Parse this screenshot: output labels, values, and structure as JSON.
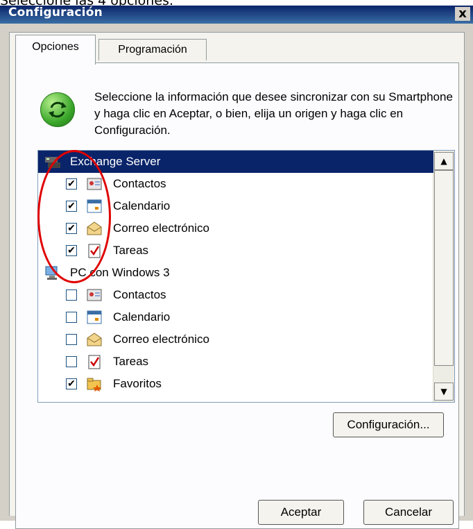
{
  "caption": "Seleccione las 4 opciones.",
  "window": {
    "title": "Configuración",
    "close_label": "x"
  },
  "tabs": [
    {
      "label": "Opciones"
    },
    {
      "label": "Programación"
    }
  ],
  "info_text": "Seleccione la información que desee sincronizar con su Smartphone y haga clic en Aceptar, o bien, elija un origen y haga clic en Configuración.",
  "tree": {
    "groups": [
      {
        "label": "Exchange Server",
        "icon": "server-icon",
        "selected": true,
        "items": [
          {
            "label": "Contactos",
            "checked": true,
            "icon": "contacts-icon"
          },
          {
            "label": "Calendario",
            "checked": true,
            "icon": "calendar-icon"
          },
          {
            "label": "Correo electrónico",
            "checked": true,
            "icon": "email-icon"
          },
          {
            "label": "Tareas",
            "checked": true,
            "icon": "tasks-icon"
          }
        ]
      },
      {
        "label": "PC con Windows 3",
        "icon": "pc-icon",
        "selected": false,
        "items": [
          {
            "label": "Contactos",
            "checked": false,
            "icon": "contacts-icon"
          },
          {
            "label": "Calendario",
            "checked": false,
            "icon": "calendar-icon"
          },
          {
            "label": "Correo electrónico",
            "checked": false,
            "icon": "email-icon"
          },
          {
            "label": "Tareas",
            "checked": false,
            "icon": "tasks-icon"
          },
          {
            "label": "Favoritos",
            "checked": true,
            "icon": "favorites-icon"
          }
        ]
      }
    ]
  },
  "buttons": {
    "config_label": "Configuración...",
    "accept_label": "Aceptar",
    "cancel_label": "Cancelar"
  },
  "colors": {
    "selection": "#0a246a",
    "annotation": "#e00000"
  }
}
